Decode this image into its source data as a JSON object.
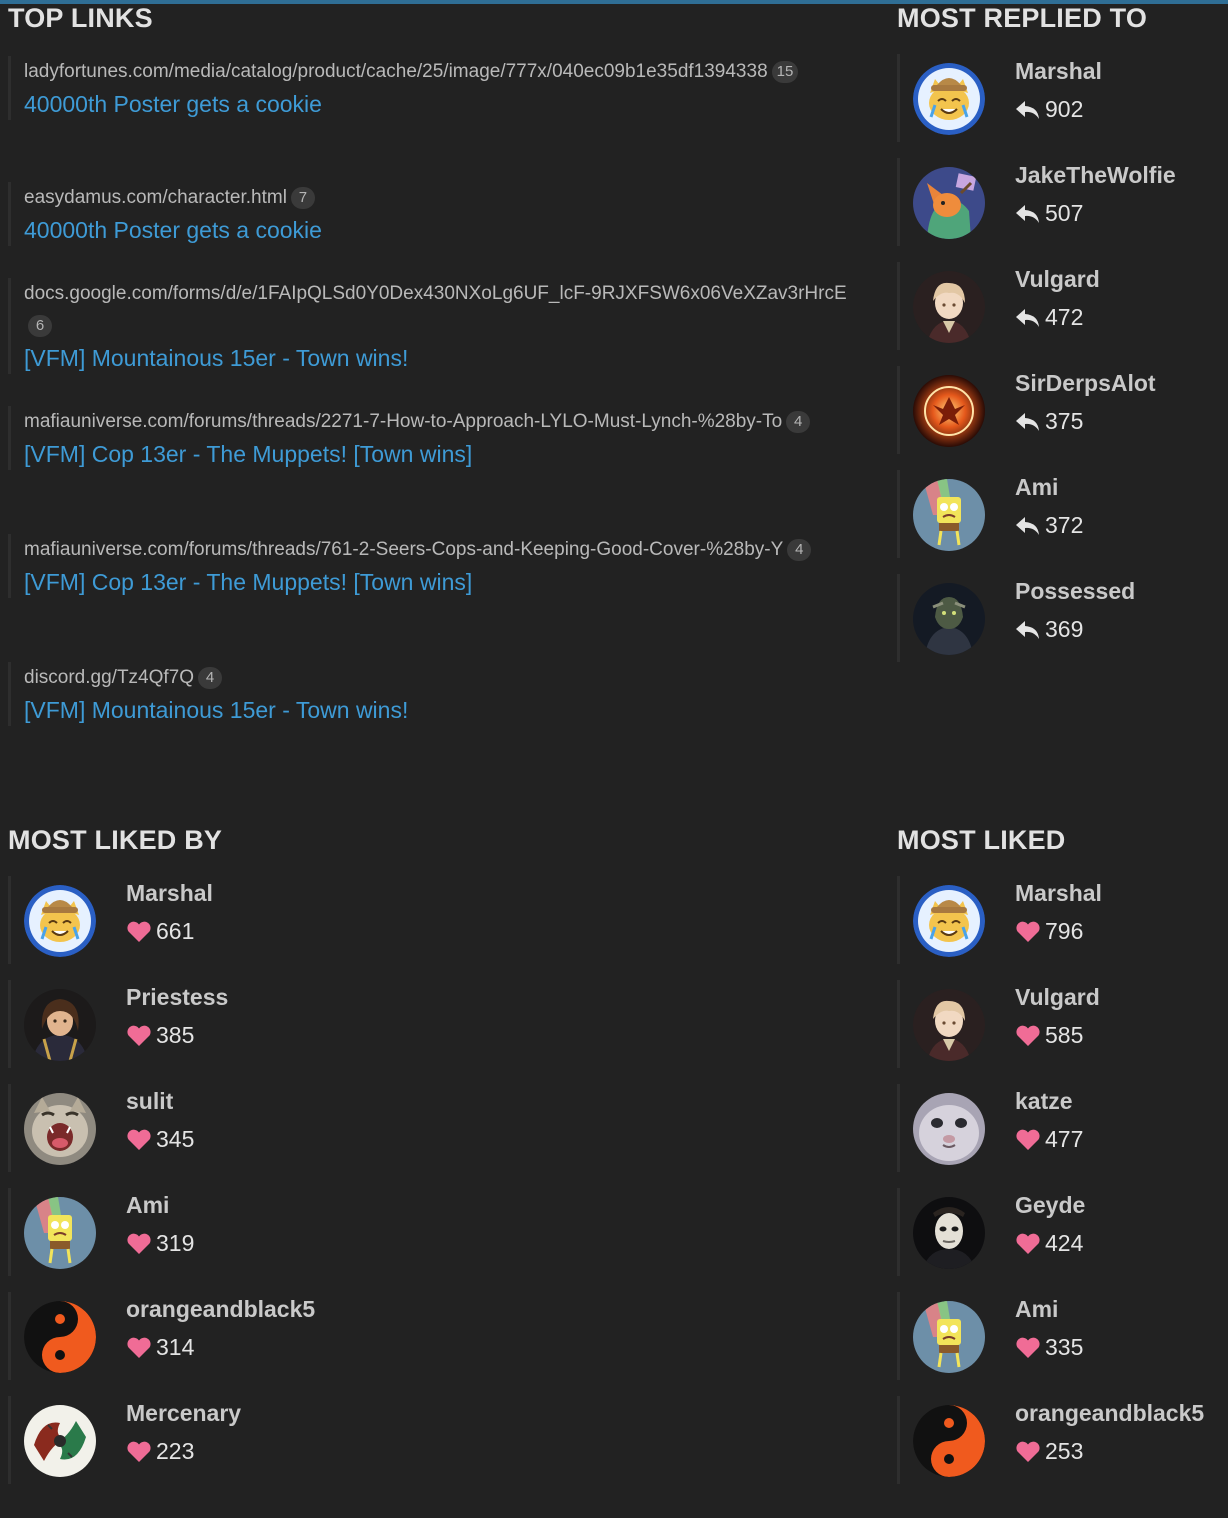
{
  "top_links": {
    "title": "TOP LINKS",
    "items": [
      {
        "url": "ladyfortunes.com/media/catalog/product/cache/25/image/777x/040ec09b1e35df1394338",
        "count": "15",
        "topic": "40000th Poster gets a cookie"
      },
      {
        "url": "easydamus.com/character.html",
        "count": "7",
        "topic": "40000th Poster gets a cookie"
      },
      {
        "url": "docs.google.com/forms/d/e/1FAIpQLSd0Y0Dex430NXoLg6UF_lcF-9RJXFSW6x06VeXZav3rHrcE",
        "count": "6",
        "topic": "[VFM] Mountainous 15er - Town wins!"
      },
      {
        "url": "mafiauniverse.com/forums/threads/2271-7-How-to-Approach-LYLO-Must-Lynch-%28by-To",
        "count": "4",
        "topic": "[VFM] Cop 13er - The Muppets! [Town wins]"
      },
      {
        "url": "mafiauniverse.com/forums/threads/761-2-Seers-Cops-and-Keeping-Good-Cover-%28by-Y",
        "count": "4",
        "topic": "[VFM] Cop 13er - The Muppets! [Town wins]"
      },
      {
        "url": "discord.gg/Tz4Qf7Q",
        "count": "4",
        "topic": "[VFM] Mountainous 15er - Town wins!"
      }
    ]
  },
  "most_replied_to": {
    "title": "MOST REPLIED TO",
    "icon": "reply-icon",
    "users": [
      {
        "name": "Marshal",
        "count": "902",
        "avatar": "marshal"
      },
      {
        "name": "JakeTheWolfie",
        "count": "507",
        "avatar": "jake"
      },
      {
        "name": "Vulgard",
        "count": "472",
        "avatar": "vulgard"
      },
      {
        "name": "SirDerpsAlot",
        "count": "375",
        "avatar": "phoenix"
      },
      {
        "name": "Ami",
        "count": "372",
        "avatar": "ami"
      },
      {
        "name": "Possessed",
        "count": "369",
        "avatar": "possessed"
      }
    ]
  },
  "most_liked_by": {
    "title": "MOST LIKED BY",
    "icon": "heart-icon",
    "users": [
      {
        "name": "Marshal",
        "count": "661",
        "avatar": "marshal"
      },
      {
        "name": "Priestess",
        "count": "385",
        "avatar": "priestess"
      },
      {
        "name": "sulit",
        "count": "345",
        "avatar": "cat"
      },
      {
        "name": "Ami",
        "count": "319",
        "avatar": "ami"
      },
      {
        "name": "orangeandblack5",
        "count": "314",
        "avatar": "yinyang"
      },
      {
        "name": "Mercenary",
        "count": "223",
        "avatar": "dragons"
      }
    ]
  },
  "most_liked": {
    "title": "MOST LIKED",
    "icon": "heart-icon",
    "users": [
      {
        "name": "Marshal",
        "count": "796",
        "avatar": "marshal"
      },
      {
        "name": "Vulgard",
        "count": "585",
        "avatar": "vulgard"
      },
      {
        "name": "katze",
        "count": "477",
        "avatar": "katze"
      },
      {
        "name": "Geyde",
        "count": "424",
        "avatar": "mask"
      },
      {
        "name": "Ami",
        "count": "335",
        "avatar": "ami"
      },
      {
        "name": "orangeandblack5",
        "count": "253",
        "avatar": "yinyang"
      }
    ]
  },
  "colors": {
    "background": "#222222",
    "link_topic": "#3e9bd6",
    "heart": "#f06c96",
    "reply_icon": "#e4e4e4",
    "top_bar": "#2f6e95"
  }
}
